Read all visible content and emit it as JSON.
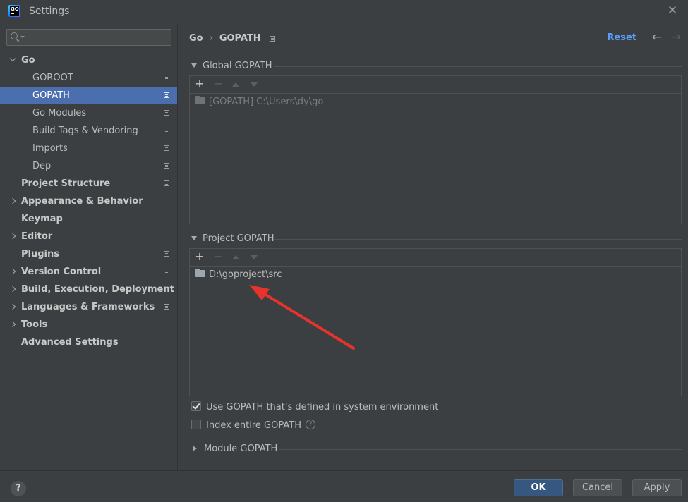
{
  "window": {
    "title": "Settings"
  },
  "search": {
    "placeholder": "",
    "value": ""
  },
  "sidebar": {
    "items": [
      {
        "label": "Go",
        "level": 0,
        "bold": true,
        "expandable": true,
        "expanded": true,
        "page_icon": false,
        "selected": false
      },
      {
        "label": "GOROOT",
        "level": 1,
        "bold": false,
        "expandable": false,
        "page_icon": true,
        "selected": false
      },
      {
        "label": "GOPATH",
        "level": 1,
        "bold": false,
        "expandable": false,
        "page_icon": true,
        "selected": true
      },
      {
        "label": "Go Modules",
        "level": 1,
        "bold": false,
        "expandable": false,
        "page_icon": true,
        "selected": false
      },
      {
        "label": "Build Tags & Vendoring",
        "level": 1,
        "bold": false,
        "expandable": false,
        "page_icon": true,
        "selected": false
      },
      {
        "label": "Imports",
        "level": 1,
        "bold": false,
        "expandable": false,
        "page_icon": true,
        "selected": false
      },
      {
        "label": "Dep",
        "level": 1,
        "bold": false,
        "expandable": false,
        "page_icon": true,
        "selected": false
      },
      {
        "label": "Project Structure",
        "level": 0,
        "bold": true,
        "expandable": false,
        "page_icon": true,
        "selected": false
      },
      {
        "label": "Appearance & Behavior",
        "level": 0,
        "bold": true,
        "expandable": true,
        "expanded": false,
        "page_icon": false,
        "selected": false
      },
      {
        "label": "Keymap",
        "level": 0,
        "bold": true,
        "expandable": false,
        "page_icon": false,
        "selected": false
      },
      {
        "label": "Editor",
        "level": 0,
        "bold": true,
        "expandable": true,
        "expanded": false,
        "page_icon": false,
        "selected": false
      },
      {
        "label": "Plugins",
        "level": 0,
        "bold": true,
        "expandable": false,
        "page_icon": true,
        "selected": false
      },
      {
        "label": "Version Control",
        "level": 0,
        "bold": true,
        "expandable": true,
        "expanded": false,
        "page_icon": true,
        "selected": false
      },
      {
        "label": "Build, Execution, Deployment",
        "level": 0,
        "bold": true,
        "expandable": true,
        "expanded": false,
        "page_icon": false,
        "selected": false
      },
      {
        "label": "Languages & Frameworks",
        "level": 0,
        "bold": true,
        "expandable": true,
        "expanded": false,
        "page_icon": true,
        "selected": false
      },
      {
        "label": "Tools",
        "level": 0,
        "bold": true,
        "expandable": true,
        "expanded": false,
        "page_icon": false,
        "selected": false
      },
      {
        "label": "Advanced Settings",
        "level": 0,
        "bold": true,
        "expandable": false,
        "page_icon": false,
        "selected": false
      }
    ]
  },
  "breadcrumb": {
    "parent": "Go",
    "separator": "›",
    "current": "GOPATH"
  },
  "header_actions": {
    "reset_label": "Reset",
    "back_icon": "arrow-left-icon",
    "forward_icon": "arrow-right-icon"
  },
  "global_gopath": {
    "title": "Global GOPATH",
    "toolbar": {
      "add": "+",
      "remove": "−"
    },
    "entries": [
      "[GOPATH] C:\\Users\\dy\\go"
    ]
  },
  "project_gopath": {
    "title": "Project GOPATH",
    "toolbar": {
      "add": "+",
      "remove": "−"
    },
    "entries": [
      "D:\\goproject\\src"
    ]
  },
  "options": {
    "use_system_gopath": {
      "label": "Use GOPATH that's defined in system environment",
      "checked": true
    },
    "index_entire_gopath": {
      "label": "Index entire GOPATH",
      "checked": false,
      "help": "?"
    }
  },
  "module_gopath": {
    "title": "Module GOPATH",
    "expanded": false
  },
  "footer": {
    "help": "?",
    "ok_label": "OK",
    "cancel_label": "Cancel",
    "apply_label": "Apply"
  },
  "annotation": {
    "color": "#e8322c"
  },
  "colors": {
    "selection": "#4b6eaf",
    "link": "#589df6",
    "primary_button": "#365880"
  }
}
